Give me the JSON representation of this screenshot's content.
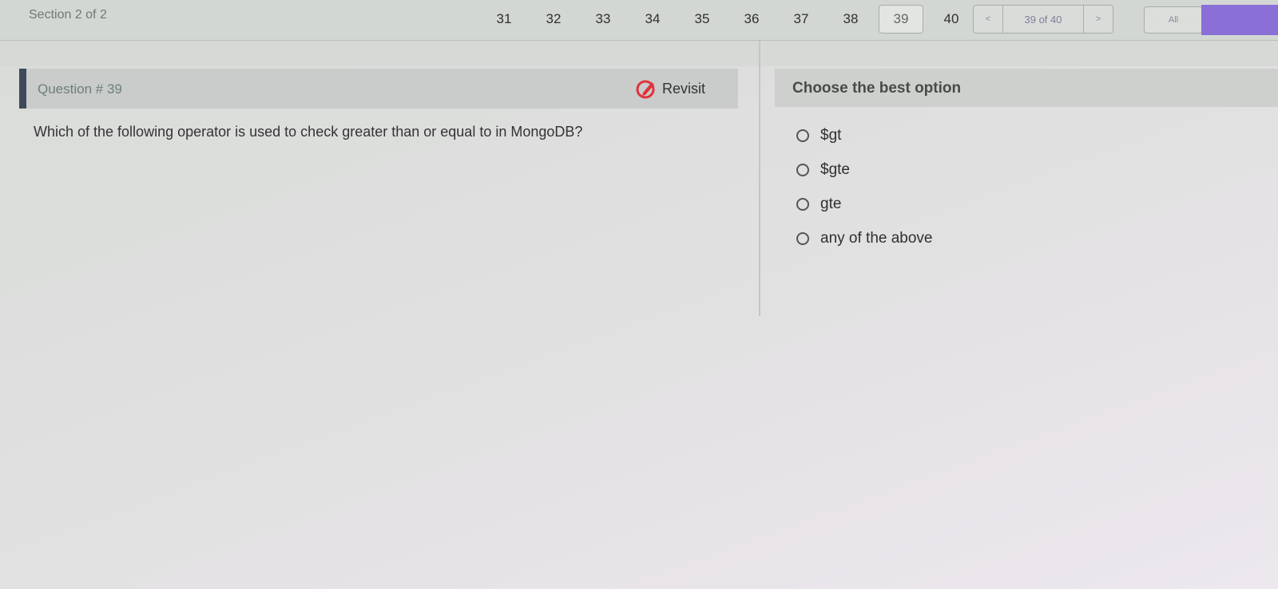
{
  "header": {
    "section_label": "Section 2 of 2",
    "question_numbers": [
      "31",
      "32",
      "33",
      "34",
      "35",
      "36",
      "37",
      "38",
      "39",
      "40"
    ],
    "current_question": "39",
    "pager": {
      "prev": "<",
      "count": "39 of 40",
      "next": ">"
    },
    "all_label": "All"
  },
  "question": {
    "title": "Question # 39",
    "revisit_label": "Revisit",
    "text": "Which of the following operator is used to check greater than or equal to in MongoDB?"
  },
  "answers": {
    "header": "Choose the best option",
    "options": [
      "$gt",
      "$gte",
      "gte",
      "any of the above"
    ]
  },
  "colors": {
    "accent_purple": "#8a6fd6",
    "revisit_red": "#e0323c",
    "question_bar": "#3e4a5a"
  }
}
